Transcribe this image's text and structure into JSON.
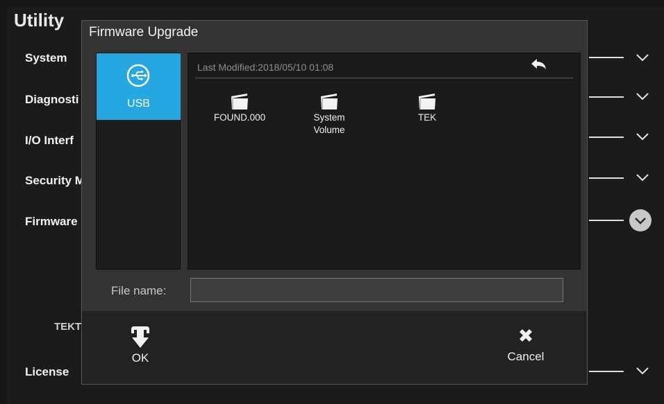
{
  "background": {
    "title": "Utility",
    "items": [
      {
        "label": "System"
      },
      {
        "label": "Diagnosti"
      },
      {
        "label": "I/O Interf"
      },
      {
        "label": "Security M"
      },
      {
        "label": "Firmware"
      },
      {
        "label": "License"
      }
    ],
    "brand_partial": "TEKT"
  },
  "dialog": {
    "title": "Firmware Upgrade",
    "sources": [
      {
        "label": "USB",
        "icon": "usb-icon",
        "selected": true
      }
    ],
    "last_modified": "Last Modified:2018/05/10 01:08",
    "back_icon": "back-arrow-icon",
    "folders": [
      {
        "name": "FOUND.000",
        "icon": "folder-icon"
      },
      {
        "name": "System\nVolume",
        "icon": "folder-icon"
      },
      {
        "name": "TEK",
        "icon": "folder-icon"
      }
    ],
    "file_name_label": "File name:",
    "file_name_value": "",
    "ok_label": "OK",
    "cancel_label": "Cancel"
  },
  "colors": {
    "accent": "#27a7e2",
    "dialog_bg": "#333333",
    "panel_bg": "#1b1b1b",
    "footer_bg": "#222222"
  }
}
